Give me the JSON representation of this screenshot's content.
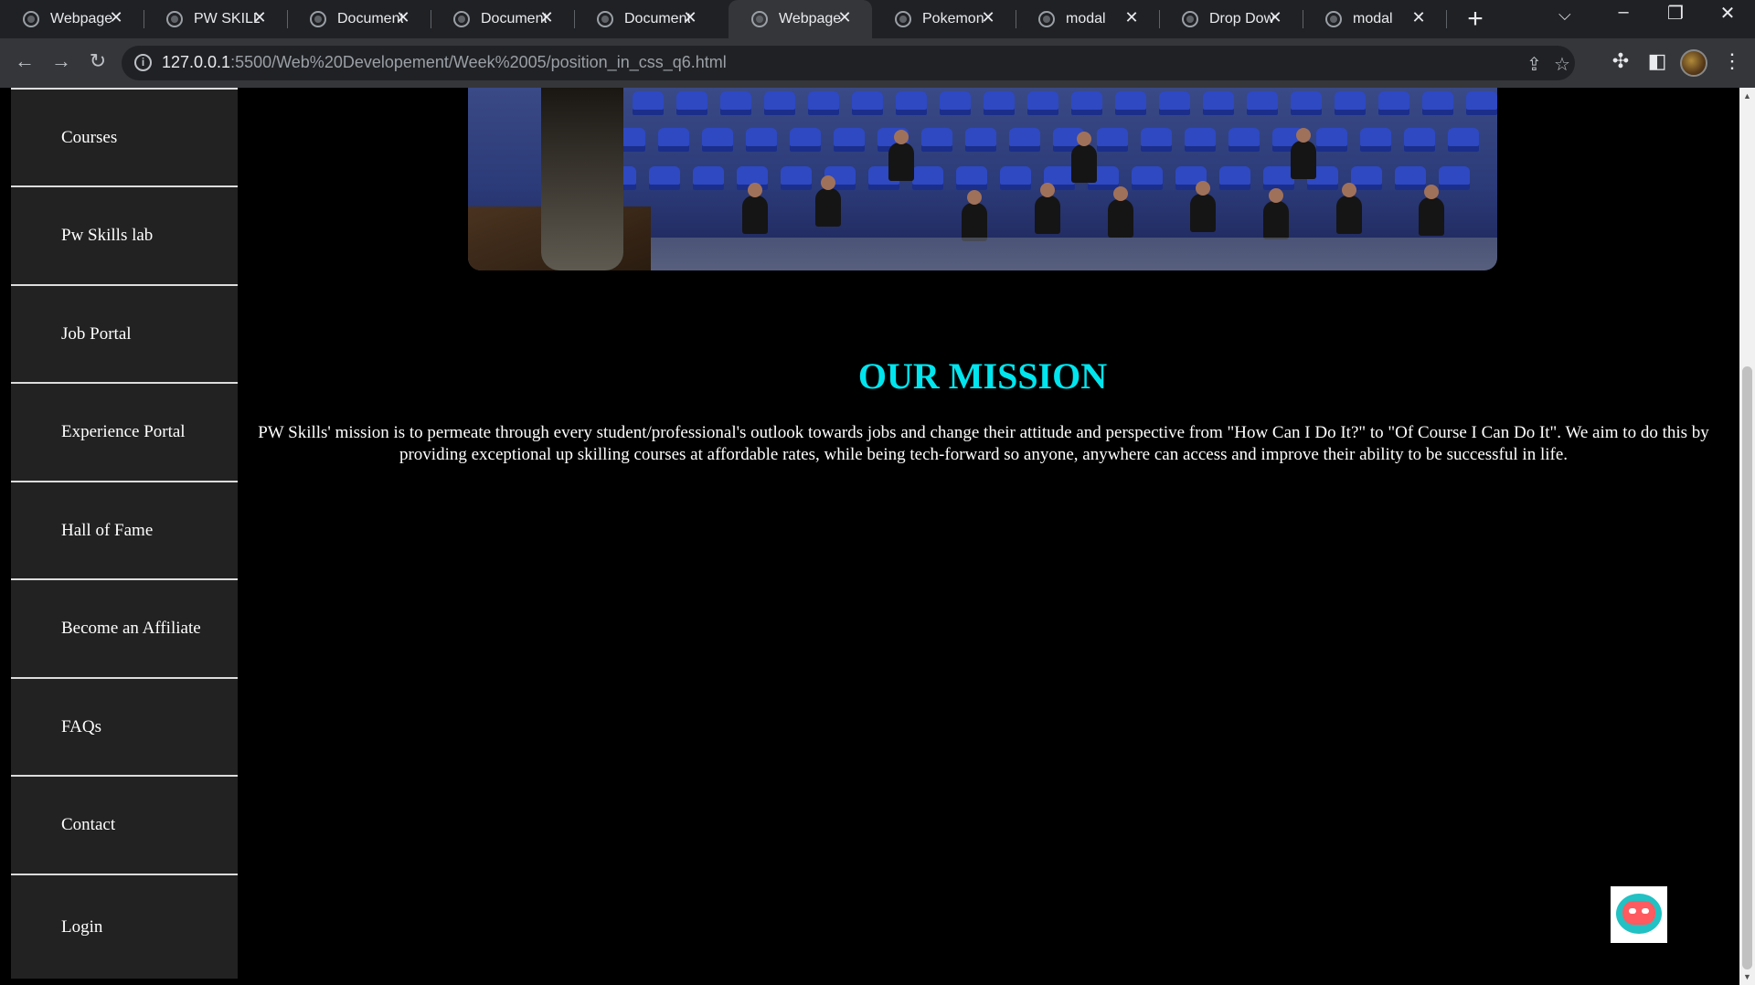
{
  "browser": {
    "tabs": [
      {
        "title": "Webpage",
        "active": false
      },
      {
        "title": "PW SKILLS",
        "active": false
      },
      {
        "title": "Document",
        "active": false
      },
      {
        "title": "Document",
        "active": false
      },
      {
        "title": "Document",
        "active": false
      },
      {
        "title": "Webpage",
        "active": true
      },
      {
        "title": "Pokemon",
        "active": false
      },
      {
        "title": "modal",
        "active": false
      },
      {
        "title": "Drop Down",
        "active": false
      },
      {
        "title": "modal",
        "active": false
      }
    ],
    "new_tab_symbol": "+",
    "url_host": "127.0.0.1",
    "url_rest": ":5500/Web%20Developement/Week%2005/position_in_css_q6.html",
    "icons": {
      "back": "back-arrow-icon",
      "forward": "forward-arrow-icon",
      "reload": "reload-icon",
      "site_info": "info-icon",
      "share": "share-icon",
      "bookmark": "star-icon",
      "extensions": "puzzle-icon",
      "side_panel": "side-panel-icon",
      "menu": "kebab-menu-icon"
    }
  },
  "sidebar": {
    "items": [
      {
        "label": "Courses"
      },
      {
        "label": "Pw Skills lab"
      },
      {
        "label": "Job Portal"
      },
      {
        "label": "Experience Portal"
      },
      {
        "label": "Hall of Fame"
      },
      {
        "label": "Become an Affiliate"
      },
      {
        "label": "FAQs"
      },
      {
        "label": "Contact"
      },
      {
        "label": "Login"
      }
    ]
  },
  "main": {
    "mission_title": "OUR MISSION",
    "mission_text": "PW Skills' mission is to permeate through every student/professional's outlook towards jobs and change their attitude and perspective from \"How Can I Do It?\" to \"Of Course I Can Do It\". We aim to do this by providing exceptional up skilling courses at affordable rates, while being tech-forward so anyone, anywhere can access and improve their ability to be successful in life."
  },
  "colors": {
    "mission_title": "#00e5ee",
    "page_background": "#000000",
    "sidebar_background": "#222222"
  },
  "chatbot": {
    "icon": "chatbot-robot-icon"
  }
}
